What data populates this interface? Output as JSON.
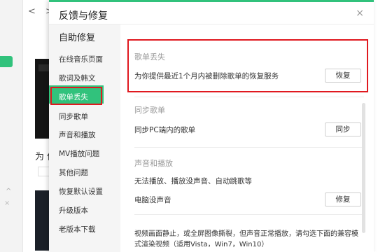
{
  "background": {
    "nav_back": "<",
    "nav_forward": ">",
    "chevron": "˅",
    "text": "为 你",
    "caret": "^",
    "close": "×"
  },
  "dialog": {
    "title": "反馈与修复",
    "close_label": "×"
  },
  "sidebar": {
    "title": "自助修复",
    "items": [
      {
        "label": "在线音乐页面"
      },
      {
        "label": "歌词及韩文"
      },
      {
        "label": "歌单丢失"
      },
      {
        "label": "同步歌单"
      },
      {
        "label": "声音和播放"
      },
      {
        "label": "MV播放问题"
      },
      {
        "label": "其他问题"
      },
      {
        "label": "恢复默认设置"
      },
      {
        "label": "升级版本"
      },
      {
        "label": "老版本下载"
      }
    ],
    "active_index": 2
  },
  "content": {
    "sections": [
      {
        "label": "歌单丢失",
        "rows": [
          {
            "text": "为你提供最近1个月内被删除歌单的恢复服务",
            "button": "恢复"
          }
        ]
      },
      {
        "label": "同步歌单",
        "rows": [
          {
            "text": "同步PC端内的歌单",
            "button": "同步"
          }
        ]
      },
      {
        "label": "声音和播放",
        "rows": [
          {
            "text": "无法播放、播放没声音、自动跳歌等",
            "button": ""
          },
          {
            "text": "电脑没声音",
            "button": "修复"
          }
        ]
      }
    ],
    "note": "视频画面静止，或全屏图像撕裂，但声音正常播放，请勾选下面的兼容模式渲染视频（适用Vista，Win7，Win10）"
  },
  "colors": {
    "accent": "#31c27c",
    "highlight_red": "#e0191f"
  }
}
